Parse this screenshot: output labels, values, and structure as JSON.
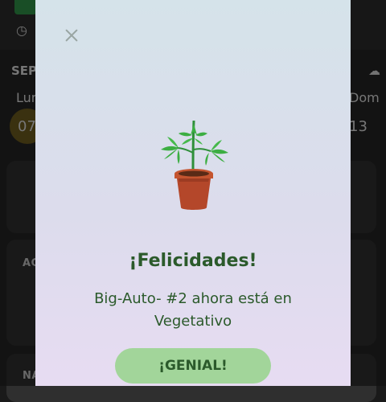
{
  "background": {
    "month": "SEP",
    "days": {
      "first": "Lun",
      "last": "Dom"
    },
    "dates": {
      "first": "07",
      "last": "13"
    },
    "cards": {
      "second_label": "AC",
      "third_label": "NA"
    }
  },
  "modal": {
    "title": "¡Felicidades!",
    "message": "Big-Auto- #2 ahora está en Vegetativo",
    "button_label": "¡GENIAL!",
    "icon": "potted-plant-icon",
    "colors": {
      "text": "#2b5a2b",
      "button": "#a2d59a",
      "plant_pot": "#b4472a",
      "leaves": "#3cae42"
    }
  }
}
